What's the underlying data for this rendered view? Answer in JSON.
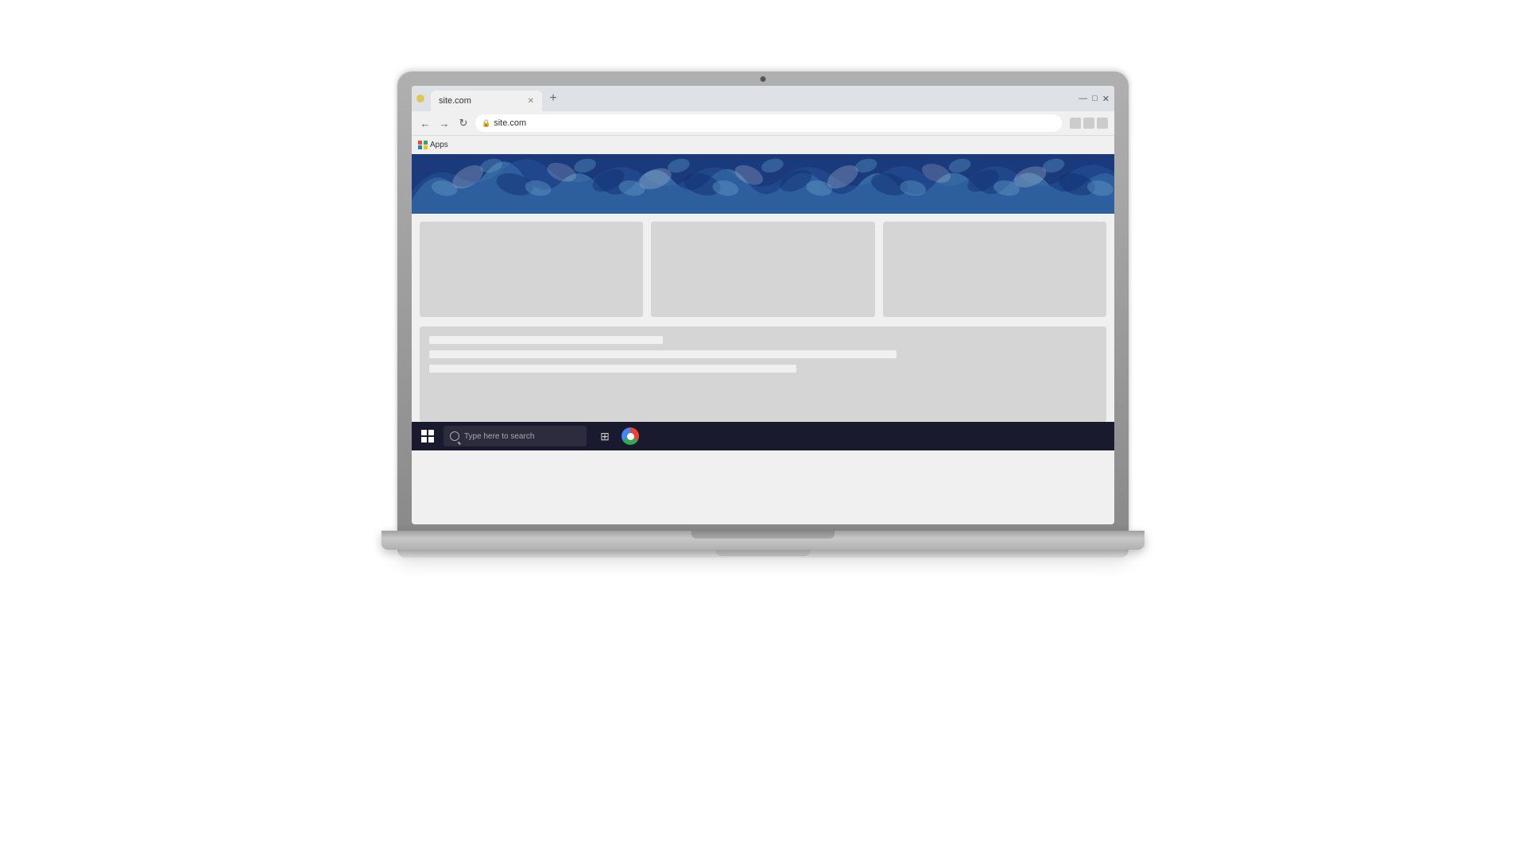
{
  "browser": {
    "tab": {
      "title": "site.com",
      "favicon": "●"
    },
    "address": "site.com",
    "bookmarks": {
      "label": "Apps"
    },
    "window_controls": {
      "minimize": "—",
      "maximize": "□",
      "close": "✕"
    }
  },
  "website": {
    "header_alt": "Decorative blue floral wave banner",
    "cards": [
      {
        "id": "card-1"
      },
      {
        "id": "card-2"
      },
      {
        "id": "card-3"
      }
    ],
    "text_bars": [
      {
        "size": "short"
      },
      {
        "size": "long"
      },
      {
        "size": "medium"
      }
    ]
  },
  "taskbar": {
    "search_placeholder": "Type here to search",
    "start_label": "Start"
  }
}
